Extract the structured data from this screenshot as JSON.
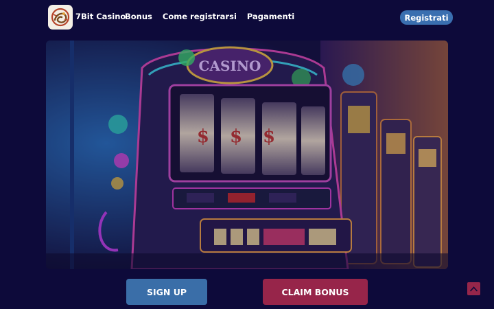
{
  "header": {
    "brand": "7Bit Casino",
    "logo_icon": "dragon-emblem-icon",
    "nav": [
      {
        "label": "Bonus"
      },
      {
        "label": "Come registrarsi"
      },
      {
        "label": "Pagamenti"
      }
    ],
    "register_label": "Registrati"
  },
  "hero": {
    "image_icon": "casino-slot-machines-image",
    "sign_text": "CASINO",
    "reel_text": "$$$"
  },
  "cta": {
    "signup_label": "SIGN UP",
    "claim_label": "CLAIM BONUS"
  },
  "scroll_top_icon": "chevron-up-icon",
  "colors": {
    "background": "#0d0a3a",
    "register": "#3a6fb0",
    "signup": "#3a6ea8",
    "claim": "#97254a",
    "scroll_top": "#96264a"
  }
}
